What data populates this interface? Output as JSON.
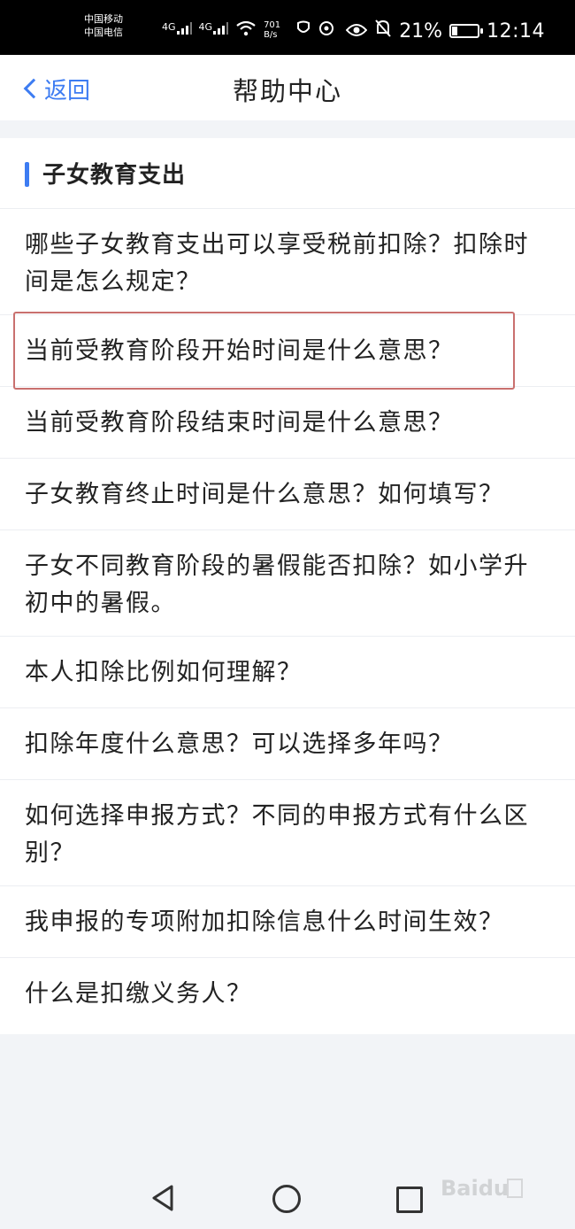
{
  "status_bar": {
    "carrier_1": "中国移动",
    "carrier_2": "中国电信",
    "network_1": "4G",
    "network_2": "4G",
    "speed": "701 B/s",
    "battery": "21%",
    "time": "12:14"
  },
  "nav": {
    "back_label": "返回",
    "title": "帮助中心"
  },
  "section": {
    "title": "子女教育支出"
  },
  "faq_items": [
    "哪些子女教育支出可以享受税前扣除？扣除时间是怎么规定？",
    "当前受教育阶段开始时间是什么意思？",
    "当前受教育阶段结束时间是什么意思？",
    "子女教育终止时间是什么意思？如何填写？",
    "子女不同教育阶段的暑假能否扣除？如小学升初中的暑假。",
    "本人扣除比例如何理解？",
    "扣除年度什么意思？可以选择多年吗？",
    "如何选择申报方式？不同的申报方式有什么区别？",
    "我申报的专项附加扣除信息什么时间生效？",
    "什么是扣缴义务人？"
  ],
  "highlighted_item": 1,
  "colors": {
    "accent": "#3d7cf2",
    "highlight_border": "#c9706e"
  }
}
